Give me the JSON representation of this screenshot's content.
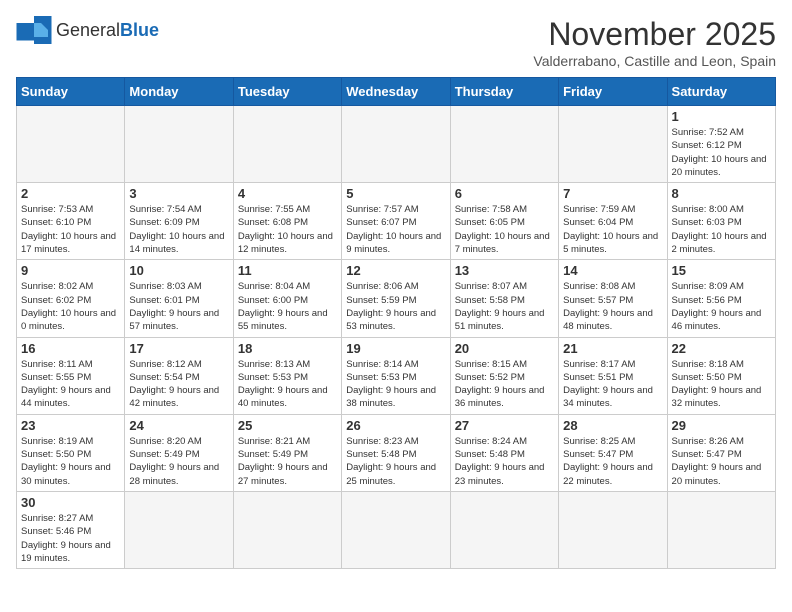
{
  "logo": {
    "text_general": "General",
    "text_blue": "Blue"
  },
  "title": "November 2025",
  "location": "Valderrabano, Castille and Leon, Spain",
  "weekdays": [
    "Sunday",
    "Monday",
    "Tuesday",
    "Wednesday",
    "Thursday",
    "Friday",
    "Saturday"
  ],
  "weeks": [
    [
      {
        "day": "",
        "info": ""
      },
      {
        "day": "",
        "info": ""
      },
      {
        "day": "",
        "info": ""
      },
      {
        "day": "",
        "info": ""
      },
      {
        "day": "",
        "info": ""
      },
      {
        "day": "",
        "info": ""
      },
      {
        "day": "1",
        "info": "Sunrise: 7:52 AM\nSunset: 6:12 PM\nDaylight: 10 hours and 20 minutes."
      }
    ],
    [
      {
        "day": "2",
        "info": "Sunrise: 7:53 AM\nSunset: 6:10 PM\nDaylight: 10 hours and 17 minutes."
      },
      {
        "day": "3",
        "info": "Sunrise: 7:54 AM\nSunset: 6:09 PM\nDaylight: 10 hours and 14 minutes."
      },
      {
        "day": "4",
        "info": "Sunrise: 7:55 AM\nSunset: 6:08 PM\nDaylight: 10 hours and 12 minutes."
      },
      {
        "day": "5",
        "info": "Sunrise: 7:57 AM\nSunset: 6:07 PM\nDaylight: 10 hours and 9 minutes."
      },
      {
        "day": "6",
        "info": "Sunrise: 7:58 AM\nSunset: 6:05 PM\nDaylight: 10 hours and 7 minutes."
      },
      {
        "day": "7",
        "info": "Sunrise: 7:59 AM\nSunset: 6:04 PM\nDaylight: 10 hours and 5 minutes."
      },
      {
        "day": "8",
        "info": "Sunrise: 8:00 AM\nSunset: 6:03 PM\nDaylight: 10 hours and 2 minutes."
      }
    ],
    [
      {
        "day": "9",
        "info": "Sunrise: 8:02 AM\nSunset: 6:02 PM\nDaylight: 10 hours and 0 minutes."
      },
      {
        "day": "10",
        "info": "Sunrise: 8:03 AM\nSunset: 6:01 PM\nDaylight: 9 hours and 57 minutes."
      },
      {
        "day": "11",
        "info": "Sunrise: 8:04 AM\nSunset: 6:00 PM\nDaylight: 9 hours and 55 minutes."
      },
      {
        "day": "12",
        "info": "Sunrise: 8:06 AM\nSunset: 5:59 PM\nDaylight: 9 hours and 53 minutes."
      },
      {
        "day": "13",
        "info": "Sunrise: 8:07 AM\nSunset: 5:58 PM\nDaylight: 9 hours and 51 minutes."
      },
      {
        "day": "14",
        "info": "Sunrise: 8:08 AM\nSunset: 5:57 PM\nDaylight: 9 hours and 48 minutes."
      },
      {
        "day": "15",
        "info": "Sunrise: 8:09 AM\nSunset: 5:56 PM\nDaylight: 9 hours and 46 minutes."
      }
    ],
    [
      {
        "day": "16",
        "info": "Sunrise: 8:11 AM\nSunset: 5:55 PM\nDaylight: 9 hours and 44 minutes."
      },
      {
        "day": "17",
        "info": "Sunrise: 8:12 AM\nSunset: 5:54 PM\nDaylight: 9 hours and 42 minutes."
      },
      {
        "day": "18",
        "info": "Sunrise: 8:13 AM\nSunset: 5:53 PM\nDaylight: 9 hours and 40 minutes."
      },
      {
        "day": "19",
        "info": "Sunrise: 8:14 AM\nSunset: 5:53 PM\nDaylight: 9 hours and 38 minutes."
      },
      {
        "day": "20",
        "info": "Sunrise: 8:15 AM\nSunset: 5:52 PM\nDaylight: 9 hours and 36 minutes."
      },
      {
        "day": "21",
        "info": "Sunrise: 8:17 AM\nSunset: 5:51 PM\nDaylight: 9 hours and 34 minutes."
      },
      {
        "day": "22",
        "info": "Sunrise: 8:18 AM\nSunset: 5:50 PM\nDaylight: 9 hours and 32 minutes."
      }
    ],
    [
      {
        "day": "23",
        "info": "Sunrise: 8:19 AM\nSunset: 5:50 PM\nDaylight: 9 hours and 30 minutes."
      },
      {
        "day": "24",
        "info": "Sunrise: 8:20 AM\nSunset: 5:49 PM\nDaylight: 9 hours and 28 minutes."
      },
      {
        "day": "25",
        "info": "Sunrise: 8:21 AM\nSunset: 5:49 PM\nDaylight: 9 hours and 27 minutes."
      },
      {
        "day": "26",
        "info": "Sunrise: 8:23 AM\nSunset: 5:48 PM\nDaylight: 9 hours and 25 minutes."
      },
      {
        "day": "27",
        "info": "Sunrise: 8:24 AM\nSunset: 5:48 PM\nDaylight: 9 hours and 23 minutes."
      },
      {
        "day": "28",
        "info": "Sunrise: 8:25 AM\nSunset: 5:47 PM\nDaylight: 9 hours and 22 minutes."
      },
      {
        "day": "29",
        "info": "Sunrise: 8:26 AM\nSunset: 5:47 PM\nDaylight: 9 hours and 20 minutes."
      }
    ],
    [
      {
        "day": "30",
        "info": "Sunrise: 8:27 AM\nSunset: 5:46 PM\nDaylight: 9 hours and 19 minutes."
      },
      {
        "day": "",
        "info": ""
      },
      {
        "day": "",
        "info": ""
      },
      {
        "day": "",
        "info": ""
      },
      {
        "day": "",
        "info": ""
      },
      {
        "day": "",
        "info": ""
      },
      {
        "day": "",
        "info": ""
      }
    ]
  ]
}
